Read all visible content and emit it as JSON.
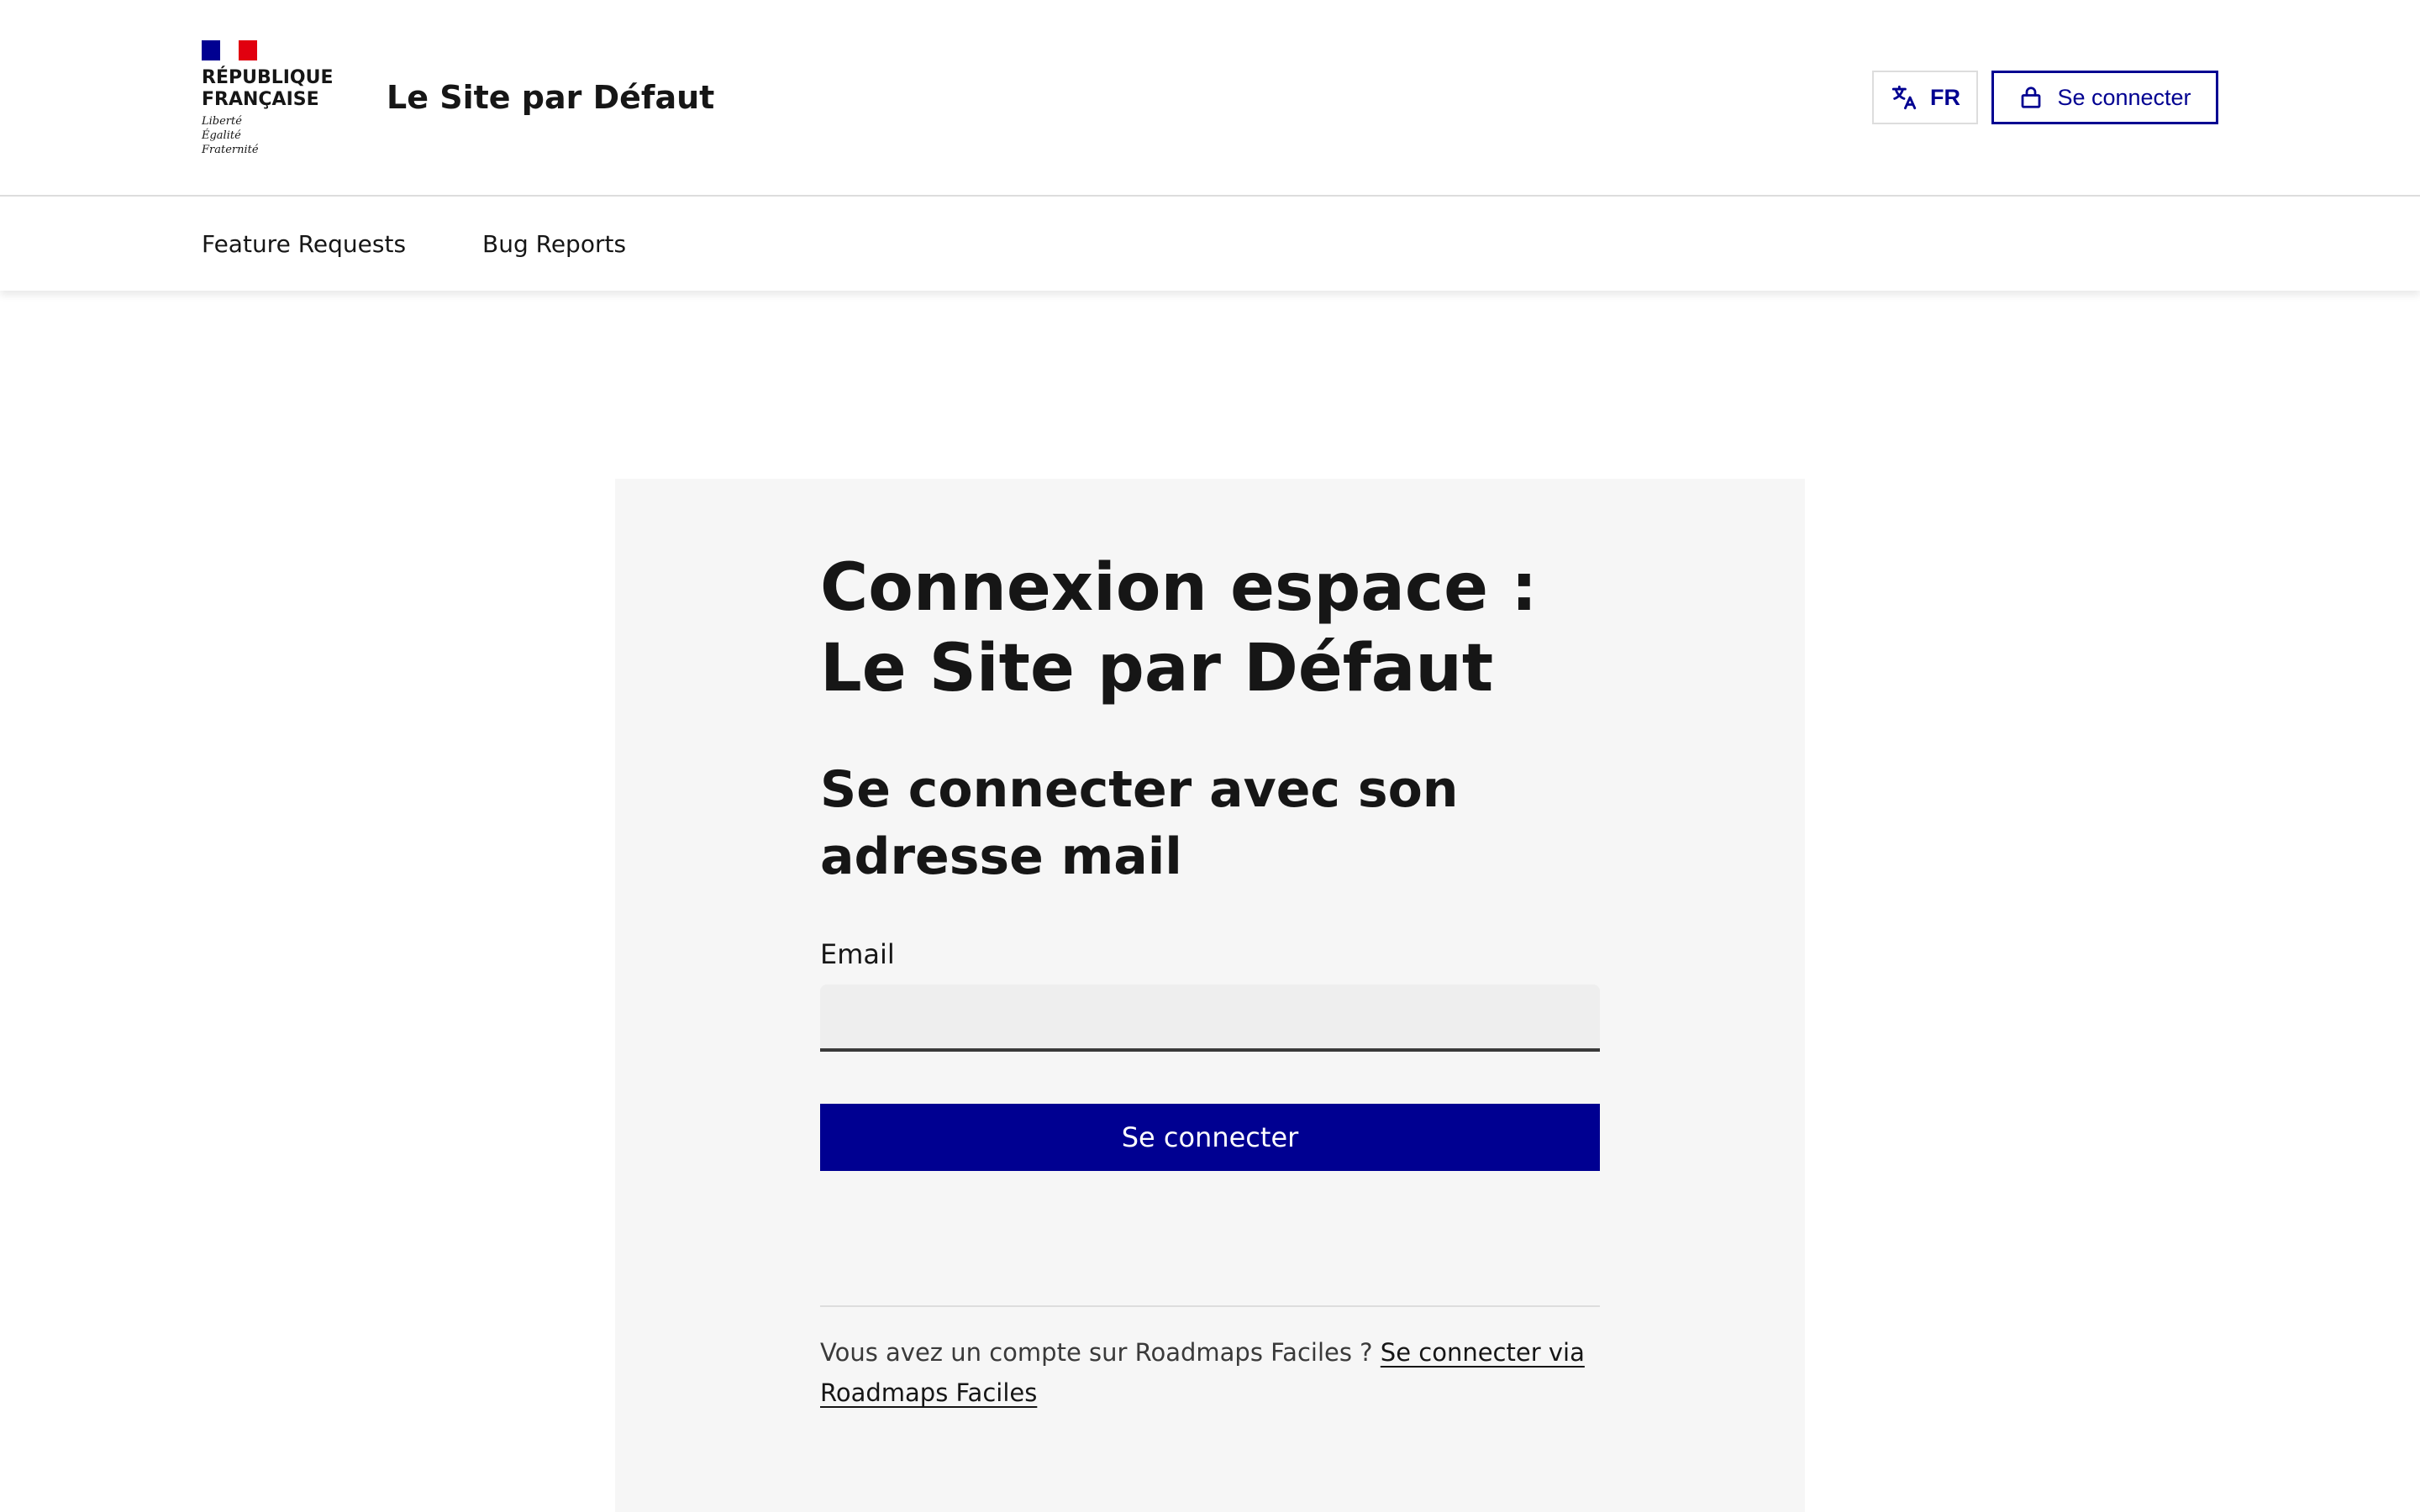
{
  "header": {
    "logo": {
      "line1": "RÉPUBLIQUE",
      "line2": "FRANÇAISE",
      "motto1": "Liberté",
      "motto2": "Égalité",
      "motto3": "Fraternité"
    },
    "site_title": "Le Site par Défaut",
    "language_button": {
      "label": "FR",
      "icon": "translate-icon"
    },
    "login_button": {
      "label": "Se connecter",
      "icon": "lock-icon"
    }
  },
  "nav": {
    "items": [
      {
        "label": "Feature Requests"
      },
      {
        "label": "Bug Reports"
      }
    ]
  },
  "login_card": {
    "title": "Connexion espace : Le Site par Défaut",
    "subtitle": "Se connecter avec son adresse mail",
    "email_label": "Email",
    "email_value": "",
    "submit_label": "Se connecter",
    "footer_text": "Vous avez un compte sur Roadmaps Faciles ? ",
    "footer_link": "Se connecter via Roadmaps Faciles"
  },
  "colors": {
    "primary": "#000091",
    "card_bg": "#f6f6f6",
    "input_bg": "#eeeeee",
    "flag_blue": "#000091",
    "flag_red": "#e1000f"
  }
}
